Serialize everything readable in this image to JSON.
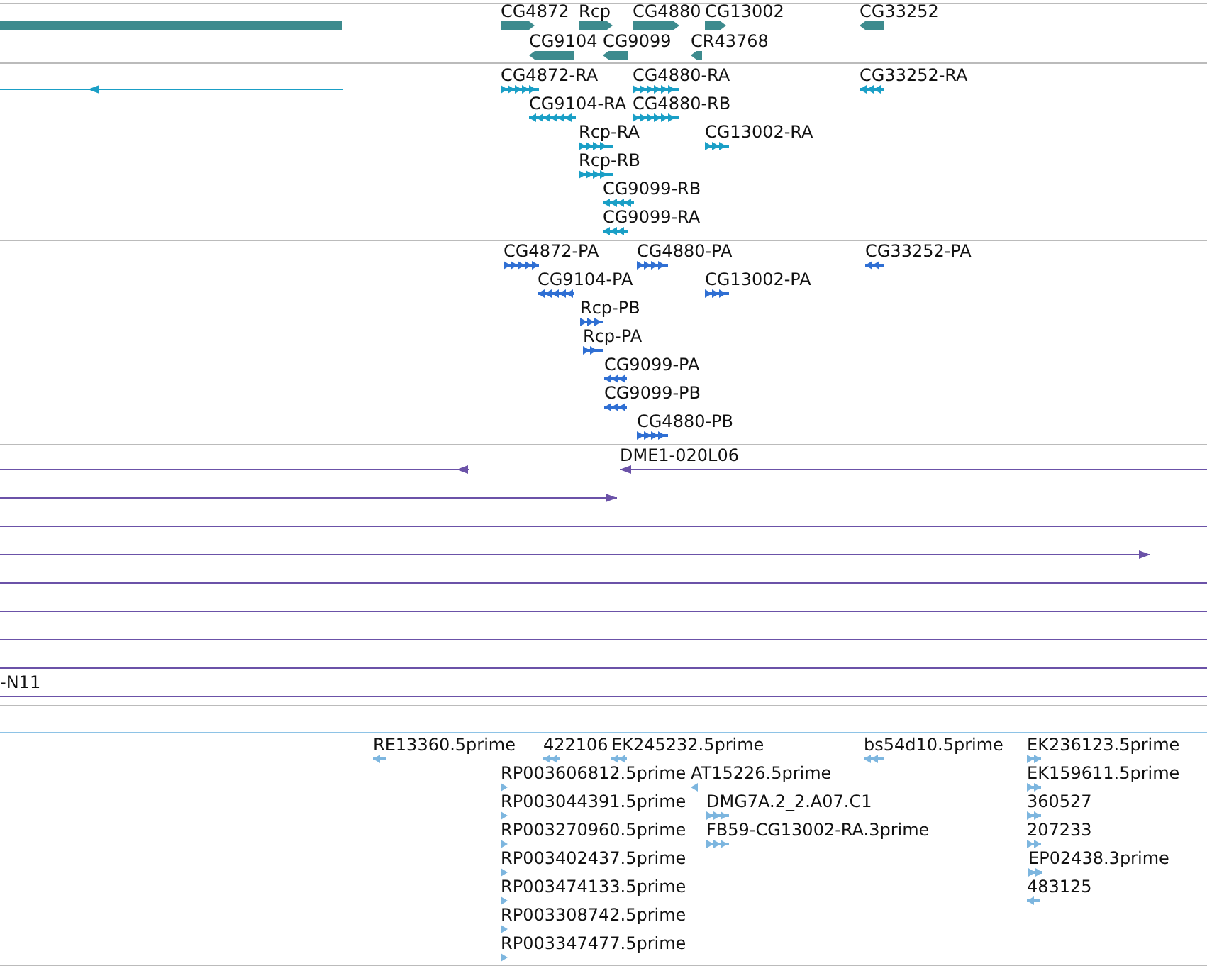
{
  "tracks": [
    {
      "kind": "genes",
      "features": [
        {
          "kind": "block"
        },
        {
          "kind": "bar",
          "label": "CG4872",
          "reverse": false
        },
        {
          "kind": "bar",
          "label": "Rcp",
          "reverse": false
        },
        {
          "kind": "bar",
          "label": "CG4880",
          "reverse": false
        },
        {
          "kind": "bar",
          "label": "CG13002",
          "reverse": false
        },
        {
          "kind": "bar",
          "label": "CG33252",
          "reverse": true
        },
        {
          "kind": "bar",
          "label": "CG9104",
          "reverse": true
        },
        {
          "kind": "bar",
          "label": "CG9099",
          "reverse": true
        },
        {
          "kind": "bar",
          "label": "CR43768",
          "reverse": true
        }
      ]
    },
    {
      "kind": "transcripts",
      "features": [
        {
          "kind": "line",
          "reverse": true
        },
        {
          "kind": "arrows",
          "label": "CG4872-RA",
          "reverse": false
        },
        {
          "kind": "arrows",
          "label": "CG4880-RA",
          "reverse": false
        },
        {
          "kind": "arrows",
          "label": "CG33252-RA",
          "reverse": true
        },
        {
          "kind": "arrows",
          "label": "CG9104-RA",
          "reverse": true
        },
        {
          "kind": "arrows",
          "label": "CG4880-RB",
          "reverse": false
        },
        {
          "kind": "arrows",
          "label": "Rcp-RA",
          "reverse": false
        },
        {
          "kind": "arrows",
          "label": "CG13002-RA",
          "reverse": false
        },
        {
          "kind": "arrows",
          "label": "Rcp-RB",
          "reverse": false
        },
        {
          "kind": "arrows",
          "label": "CG9099-RB",
          "reverse": true
        },
        {
          "kind": "arrows",
          "label": "CG9099-RA",
          "reverse": true
        }
      ]
    },
    {
      "kind": "proteins",
      "features": [
        {
          "kind": "arrows",
          "label": "CG4872-PA",
          "reverse": false
        },
        {
          "kind": "arrows",
          "label": "CG4880-PA",
          "reverse": false
        },
        {
          "kind": "arrows",
          "label": "CG33252-PA",
          "reverse": true
        },
        {
          "kind": "arrows",
          "label": "CG9104-PA",
          "reverse": true
        },
        {
          "kind": "arrows",
          "label": "CG13002-PA",
          "reverse": false
        },
        {
          "kind": "arrows",
          "label": "Rcp-PB",
          "reverse": false
        },
        {
          "kind": "arrows",
          "label": "Rcp-PA",
          "reverse": false
        },
        {
          "kind": "arrows",
          "label": "CG9099-PA",
          "reverse": true
        },
        {
          "kind": "arrows",
          "label": "CG9099-PB",
          "reverse": true
        },
        {
          "kind": "arrows",
          "label": "CG4880-PB",
          "reverse": false
        }
      ]
    },
    {
      "kind": "alignments",
      "features": [
        {
          "kind": "line",
          "reverse": true
        },
        {
          "kind": "line",
          "label": "DME1-020L06",
          "reverse": true
        },
        {
          "kind": "line",
          "reverse": false
        },
        {
          "kind": "rule"
        },
        {
          "kind": "line",
          "reverse": false
        },
        {
          "kind": "rule"
        },
        {
          "kind": "rule"
        },
        {
          "kind": "rule"
        },
        {
          "kind": "rule"
        },
        {
          "kind": "rule",
          "label": "-N11"
        }
      ]
    },
    {
      "kind": "empty"
    },
    {
      "kind": "ests",
      "features": [
        {
          "kind": "arrows",
          "label": "RE13360.5prime",
          "reverse": true
        },
        {
          "kind": "arrows",
          "label": "422106",
          "reverse": true
        },
        {
          "kind": "arrows",
          "label": "EK245232.5prime",
          "reverse": true
        },
        {
          "kind": "arrows",
          "label": "bs54d10.5prime",
          "reverse": true
        },
        {
          "kind": "arrows",
          "label": "EK236123.5prime",
          "reverse": false
        },
        {
          "kind": "arrows",
          "label": "RP003606812.5prime",
          "reverse": false
        },
        {
          "kind": "arrows",
          "label": "AT15226.5prime",
          "reverse": true
        },
        {
          "kind": "arrows",
          "label": "EK159611.5prime",
          "reverse": false
        },
        {
          "kind": "arrows",
          "label": "RP003044391.5prime",
          "reverse": false
        },
        {
          "kind": "arrows",
          "label": "DMG7A.2_2.A07.C1",
          "reverse": false
        },
        {
          "kind": "arrows",
          "label": "360527",
          "reverse": false
        },
        {
          "kind": "arrows",
          "label": "RP003270960.5prime",
          "reverse": false
        },
        {
          "kind": "arrows",
          "label": "FB59-CG13002-RA.3prime",
          "reverse": false
        },
        {
          "kind": "arrows",
          "label": "207233",
          "reverse": false
        },
        {
          "kind": "arrows",
          "label": "RP003402437.5prime",
          "reverse": false
        },
        {
          "kind": "arrows",
          "label": "EP02438.3prime",
          "reverse": false
        },
        {
          "kind": "arrows",
          "label": "RP003474133.5prime",
          "reverse": false
        },
        {
          "kind": "arrows",
          "label": "483125",
          "reverse": true
        },
        {
          "kind": "arrows",
          "label": "RP003308742.5prime",
          "reverse": false
        },
        {
          "kind": "arrows",
          "label": "RP003347477.5prime",
          "reverse": false
        }
      ]
    }
  ]
}
